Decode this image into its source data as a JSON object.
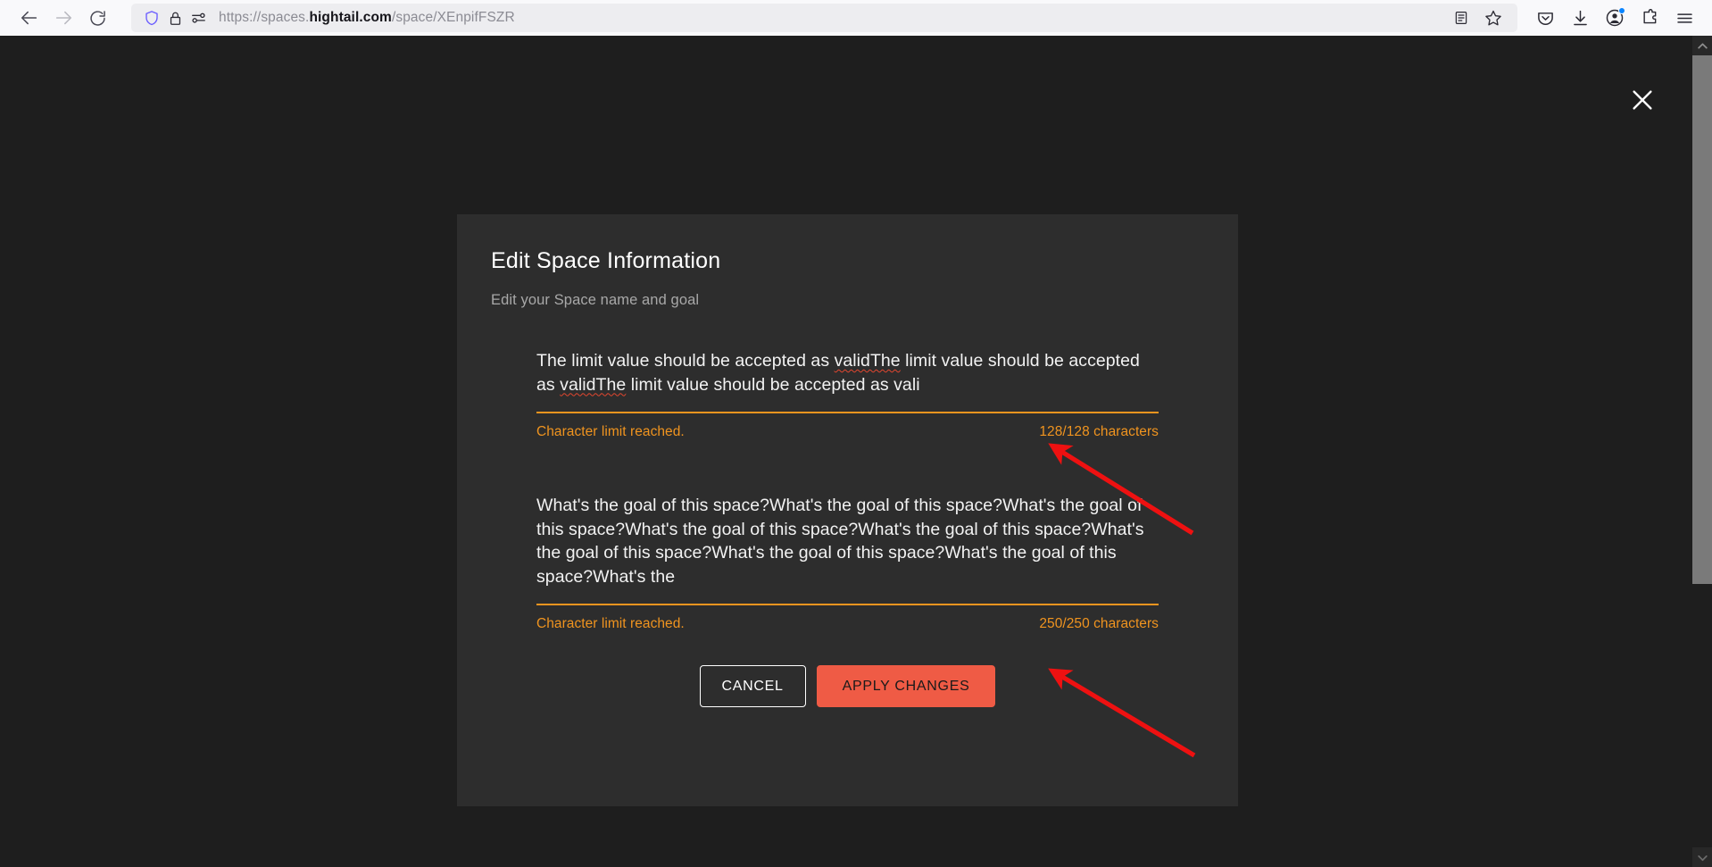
{
  "browser": {
    "back_label": "Back",
    "forward_label": "Forward",
    "reload_label": "Reload",
    "url_prefix": "https://spaces.",
    "url_domain": "hightail.com",
    "url_suffix": "/space/XEnpifFSZR",
    "shield_icon": "shield-icon",
    "lock_icon": "lock-icon",
    "permissions_icon": "permissions-icon",
    "reader_icon": "reader-view-icon",
    "bookmark_icon": "bookmark-star-icon",
    "pocket_icon": "pocket-icon",
    "downloads_icon": "downloads-icon",
    "account_icon": "account-icon",
    "extensions_icon": "extensions-icon",
    "menu_icon": "hamburger-menu-icon"
  },
  "page": {
    "close_label": "Close",
    "scrollbar_up": "scroll-up",
    "scrollbar_down": "scroll-down"
  },
  "dialog": {
    "title": "Edit Space Information",
    "subtitle": "Edit your Space name and goal",
    "name_field": {
      "value_part1": "The limit value should be accepted as ",
      "value_spell1": "validThe",
      "value_part2": " limit value should be accepted as ",
      "value_spell2": "validThe",
      "value_part3": " limit value should be accepted as vali",
      "full_value": "The limit value should be accepted as validThe limit value should be accepted as validThe limit value should be accepted as vali",
      "warning": "Character limit reached.",
      "counter": "128/128 characters",
      "max": 128,
      "current": 128
    },
    "goal_field": {
      "value": "What's the goal of this space?What's the goal of this space?What's the goal of this space?What's the goal of this space?What's the goal of this space?What's the goal of this space?What's the goal of this space?What's the goal of this space?What's the",
      "warning": "Character limit reached.",
      "counter": "250/250 characters",
      "max": 250,
      "current": 250
    },
    "cancel_label": "CANCEL",
    "apply_label": "APPLY CHANGES"
  },
  "colors": {
    "accent_orange": "#f0941f",
    "apply_button": "#ef5b45",
    "dialog_bg": "#2d2d2d",
    "page_bg": "#1e1e1e",
    "annotation_red": "#ee1111"
  },
  "annotations": [
    {
      "name": "arrow-to-name-counter",
      "points_to": "128/128 characters"
    },
    {
      "name": "arrow-to-goal-counter",
      "points_to": "250/250 characters"
    }
  ]
}
